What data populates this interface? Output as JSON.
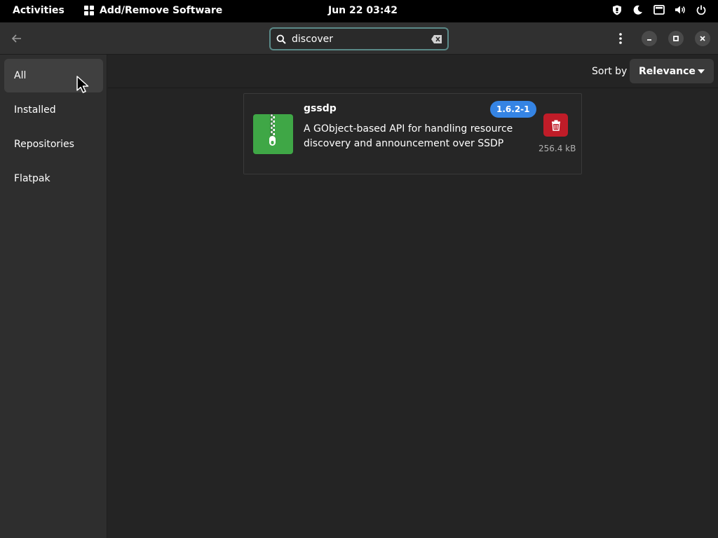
{
  "topbar": {
    "activities": "Activities",
    "app_name": "Add/Remove Software",
    "clock": "Jun 22  03:42",
    "tray_icons": [
      "shield-icon",
      "night-light-icon",
      "display-icon",
      "volume-icon",
      "power-icon"
    ]
  },
  "header": {
    "back_icon": "arrow-left-icon",
    "search": {
      "value": "discover",
      "placeholder": ""
    },
    "menu_icon": "kebab-menu-icon",
    "window_controls": [
      "minimize-icon",
      "maximize-icon",
      "close-icon"
    ]
  },
  "sidebar": {
    "items": [
      {
        "label": "All",
        "selected": true
      },
      {
        "label": "Installed",
        "selected": false
      },
      {
        "label": "Repositories",
        "selected": false
      },
      {
        "label": "Flatpak",
        "selected": false
      }
    ]
  },
  "sort": {
    "label": "Sort by",
    "value": "Relevance"
  },
  "results": [
    {
      "name": "gssdp",
      "version": "1.6.2-1",
      "description": "A GObject-based API for handling resource discovery and announcement over SSDP",
      "size": "256.4 kB",
      "icon": "package-archive-icon",
      "action_icon": "trash-icon"
    }
  ],
  "colors": {
    "accent": "#3584e4",
    "destructive": "#c01c28",
    "package_icon": "#3fa746",
    "focus_ring": "#5a8a88"
  }
}
